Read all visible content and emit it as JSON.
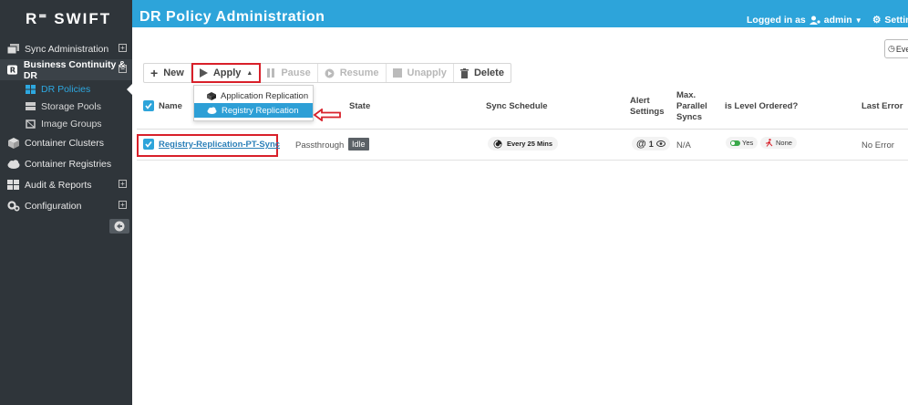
{
  "brand": {
    "logo_text": "SWIFT"
  },
  "header": {
    "title": "DR Policy Administration",
    "logged_in_label": "Logged in as",
    "user": "admin",
    "settings_label": "Settin"
  },
  "sidebar": {
    "items": [
      {
        "label": "Sync Administration",
        "icon": "sync-admin-icon",
        "expandable": true
      },
      {
        "label": "Business Continuity & DR",
        "icon": "business-continuity-icon",
        "expandable": true,
        "active": true
      },
      {
        "label": "Container Clusters",
        "icon": "cube-icon",
        "expandable": false
      },
      {
        "label": "Container Registries",
        "icon": "cloud-icon",
        "expandable": false
      },
      {
        "label": "Audit & Reports",
        "icon": "table-icon",
        "expandable": true
      },
      {
        "label": "Configuration",
        "icon": "gears-icon",
        "expandable": true
      }
    ],
    "sub_items": [
      {
        "label": "DR Policies",
        "active": true
      },
      {
        "label": "Storage Pools"
      },
      {
        "label": "Image Groups"
      }
    ]
  },
  "event_box_label": "Eve",
  "toolbar": {
    "new_label": "New",
    "apply_label": "Apply",
    "pause_label": "Pause",
    "resume_label": "Resume",
    "unapply_label": "Unapply",
    "delete_label": "Delete"
  },
  "apply_menu": {
    "items": [
      {
        "label": "Application Replication"
      },
      {
        "label": "Registry Replication",
        "selected": true
      }
    ]
  },
  "table": {
    "headers": {
      "name": "Name",
      "state": "State",
      "sync_schedule": "Sync Schedule",
      "alert_settings_1": "Alert",
      "alert_settings_2": "Settings",
      "max_parallel_1": "Max.",
      "max_parallel_2": "Parallel",
      "max_parallel_3": "Syncs",
      "level_ordered": "is Level Ordered?",
      "last_error": "Last Error"
    },
    "rows": [
      {
        "name": "Registry-Replication-PT-Sync",
        "type": "Passthrough",
        "state": "Idle",
        "sync_schedule": "Every 25 Mins",
        "alert_at": "@",
        "alert_count": "1",
        "max_parallel": "N/A",
        "level_ordered": "Yes",
        "level_none": "None",
        "last_error": "No Error"
      }
    ]
  },
  "colors": {
    "header_blue": "#2da4da",
    "sidebar_dark": "#2f353a",
    "highlight_red": "#d8202a",
    "link_blue": "#2a7fb8"
  }
}
